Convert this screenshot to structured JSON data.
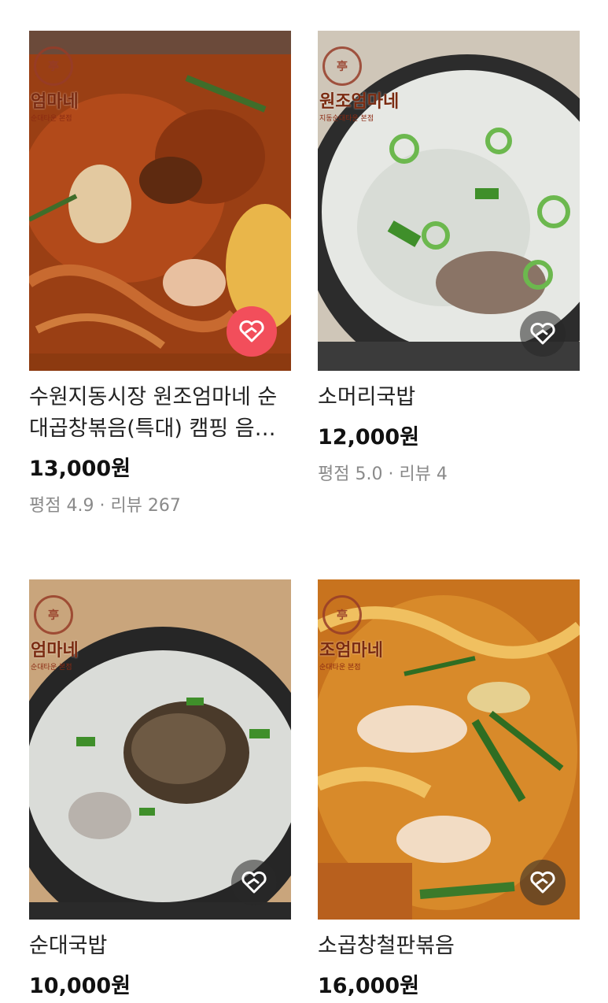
{
  "products": [
    {
      "title": "수원지동시장 원조엄마네 순대곱창볶음(특대) 캠핑 음식 밀키트",
      "price": "13,000원",
      "rating_text": "평점 4.9 · 리뷰 267",
      "liked": true,
      "image_icon": "spicy-stir-fried-intestine-photo",
      "logo": {
        "name": "엄마네",
        "sub": "순대타운 본점"
      }
    },
    {
      "title": "소머리국밥",
      "price": "12,000원",
      "rating_text": "평점 5.0 · 리뷰 4",
      "liked": false,
      "image_icon": "beef-head-soup-photo",
      "logo": {
        "name": "원조엄마네",
        "sub": "지동순대타운 본점"
      }
    },
    {
      "title": "순대국밥",
      "price": "10,000원",
      "liked": false,
      "image_icon": "sundae-soup-photo",
      "logo": {
        "name": "엄마네",
        "sub": "순대타운 본점"
      }
    },
    {
      "title": "소곱창철판볶음",
      "price": "16,000원",
      "liked": false,
      "image_icon": "beef-intestine-stir-fry-photo",
      "logo": {
        "name": "조엄마네",
        "sub": "순대타운 본점"
      }
    }
  ],
  "colors": {
    "liked_heart_bg": "#f24e5b",
    "price": "#111111",
    "meta": "#8a8a8a"
  }
}
